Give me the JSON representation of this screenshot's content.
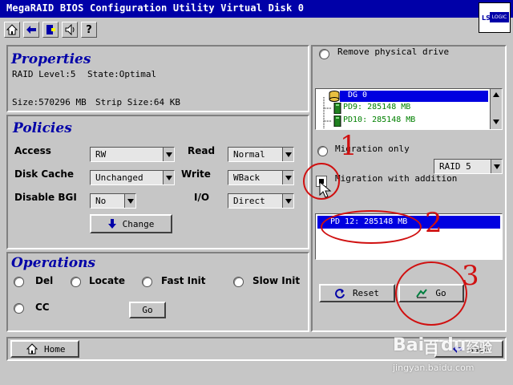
{
  "window": {
    "title": "MegaRAID BIOS Configuration Utility Virtual Disk 0",
    "logo_text": "LSI LOGIC"
  },
  "toolbar": {
    "icons": [
      "home-icon",
      "back-icon",
      "exit-icon",
      "sound-icon",
      "help-icon"
    ]
  },
  "properties": {
    "heading": "Properties",
    "raid_level": "RAID Level:5",
    "state": "State:Optimal",
    "size": "Size:570296 MB",
    "strip_size": "Strip Size:64 KB"
  },
  "policies": {
    "heading": "Policies",
    "access_label": "Access",
    "access_value": "RW",
    "read_label": "Read",
    "read_value": "Normal",
    "disk_cache_label": "Disk Cache",
    "disk_cache_value": "Unchanged",
    "write_label": "Write",
    "write_value": "WBack",
    "disable_bgi_label": "Disable BGI",
    "disable_bgi_value": "No",
    "io_label": "I/O",
    "io_value": "Direct",
    "change_label": "Change"
  },
  "operations": {
    "heading": "Operations",
    "options": [
      "Del",
      "Locate",
      "Fast Init",
      "Slow Init",
      "CC"
    ],
    "go_label": "Go"
  },
  "right": {
    "remove_label": "Remove physical drive",
    "tree": [
      "DG 0",
      "PD9: 285148 MB",
      "PD10: 285148 MB"
    ],
    "migration_only": "Migration only",
    "migration_addition": "Migration with addition",
    "raid_select": "RAID 5",
    "selected_drive": "PD 12: 285148 MB",
    "reset_label": "Reset",
    "go_label": "Go"
  },
  "bottom": {
    "home_label": "Home",
    "back_label": "Back"
  },
  "annotations": {
    "numbers": [
      "1",
      "2",
      "3"
    ],
    "color": "#d01010"
  },
  "watermark": {
    "brand": "Bai",
    "brand2": "百",
    "brand3": "du",
    "brand4": "经验",
    "url": "jingyan.baidu.com"
  },
  "colors": {
    "title_bar": "#0000a8",
    "selection": "#0000e0",
    "panel": "#c6c6c6"
  }
}
